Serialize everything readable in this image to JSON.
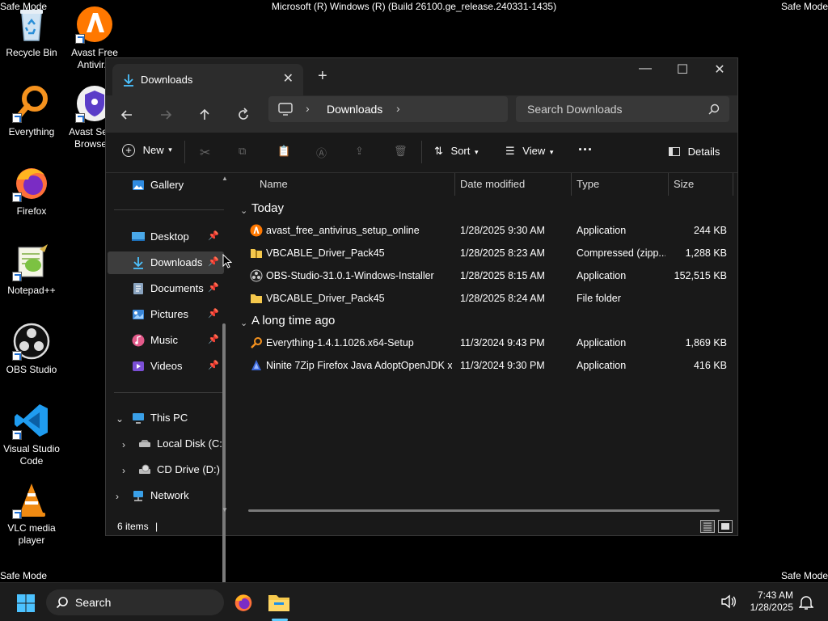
{
  "safe_mode": "Safe Mode",
  "build_banner": "Microsoft (R) Windows (R) (Build 26100.ge_release.240331-1435)",
  "desktop_icons": [
    {
      "label": "Recycle Bin"
    },
    {
      "label": "Everything"
    },
    {
      "label": "Firefox"
    },
    {
      "label": "Notepad++"
    },
    {
      "label": "OBS Studio"
    },
    {
      "label": "Visual Studio Code"
    },
    {
      "label": "VLC media player"
    },
    {
      "label": "Avast Free Antivir..."
    },
    {
      "label": "Avast Sec... Browse..."
    }
  ],
  "window": {
    "tab_title": "Downloads",
    "new_tab": "+",
    "address": "Downloads",
    "search_placeholder": "Search Downloads",
    "toolbar": {
      "new": "New",
      "sort": "Sort",
      "view": "View",
      "more": "···",
      "details": "Details"
    },
    "nav": {
      "gallery": "Gallery",
      "quick_access": [
        {
          "label": "Desktop"
        },
        {
          "label": "Downloads"
        },
        {
          "label": "Documents"
        },
        {
          "label": "Pictures"
        },
        {
          "label": "Music"
        },
        {
          "label": "Videos"
        }
      ],
      "this_pc": "This PC",
      "drives": [
        {
          "label": "Local Disk (C:)"
        },
        {
          "label": "CD Drive (D:)"
        }
      ],
      "network": "Network"
    },
    "columns": {
      "name": "Name",
      "date": "Date modified",
      "type": "Type",
      "size": "Size"
    },
    "groups": [
      {
        "label": "Today",
        "files": [
          {
            "name": "avast_free_antivirus_setup_online",
            "date": "1/28/2025 9:30 AM",
            "type": "Application",
            "size": "244 KB",
            "icon": "avast-icon"
          },
          {
            "name": "VBCABLE_Driver_Pack45",
            "date": "1/28/2025 8:23 AM",
            "type": "Compressed (zipp...",
            "size": "1,288 KB",
            "icon": "zip-folder-icon"
          },
          {
            "name": "OBS-Studio-31.0.1-Windows-Installer",
            "date": "1/28/2025 8:15 AM",
            "type": "Application",
            "size": "152,515 KB",
            "icon": "obs-icon"
          },
          {
            "name": "VBCABLE_Driver_Pack45",
            "date": "1/28/2025 8:24 AM",
            "type": "File folder",
            "size": "",
            "icon": "folder-icon"
          }
        ]
      },
      {
        "label": "A long time ago",
        "files": [
          {
            "name": "Everything-1.4.1.1026.x64-Setup",
            "date": "11/3/2024 9:43 PM",
            "type": "Application",
            "size": "1,869 KB",
            "icon": "everything-icon"
          },
          {
            "name": "Ninite 7Zip Firefox Java AdoptOpenJDK x...",
            "date": "11/3/2024 9:30 PM",
            "type": "Application",
            "size": "416 KB",
            "icon": "ninite-icon"
          }
        ]
      }
    ],
    "status": "6 items"
  },
  "taskbar": {
    "search": "Search",
    "time": "7:43 AM",
    "date": "1/28/2025"
  }
}
